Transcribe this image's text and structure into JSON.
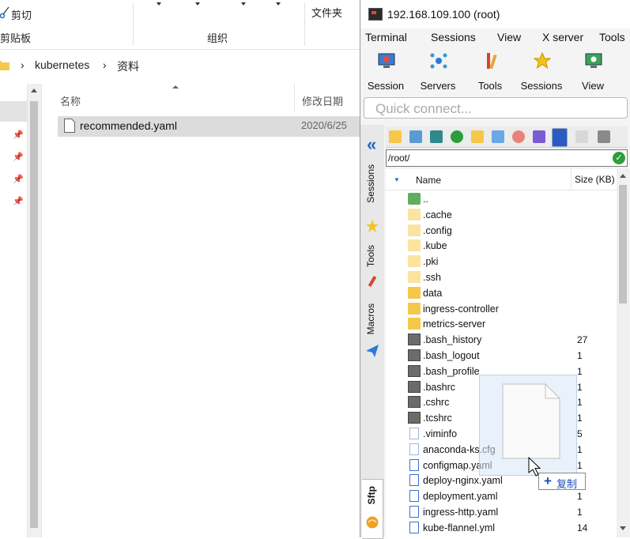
{
  "explorer": {
    "ribbon": {
      "cut_label": "剪切",
      "clipboard_group": "剪贴板",
      "organize_group": "组织",
      "new_folder_label": "文件夹"
    },
    "breadcrumb": [
      "kubernetes",
      "资料"
    ],
    "breadcrumb_separator": "›",
    "columns": {
      "name": "名称",
      "date": "修改日期"
    },
    "files": [
      {
        "name": "recommended.yaml",
        "date": "2020/6/25"
      }
    ]
  },
  "moba": {
    "title": "192.168.109.100 (root)",
    "menu": [
      "Terminal",
      "Sessions",
      "View",
      "X server",
      "Tools"
    ],
    "toolbar": [
      {
        "label": "Session",
        "icon": "monitor-session-icon"
      },
      {
        "label": "Servers",
        "icon": "servers-icon"
      },
      {
        "label": "Tools",
        "icon": "tools-icon"
      },
      {
        "label": "Sessions",
        "icon": "star-sessions-icon"
      },
      {
        "label": "View",
        "icon": "view-monitor-icon"
      }
    ],
    "quick_connect_placeholder": "Quick connect...",
    "side_tabs": [
      "Sessions",
      "Tools",
      "Macros",
      "Sftp"
    ],
    "path": "/root/",
    "list_headers": {
      "name": "Name",
      "size": "Size (KB)"
    },
    "files": [
      {
        "name": "..",
        "type": "up",
        "size": ""
      },
      {
        "name": ".cache",
        "type": "folder-light",
        "size": ""
      },
      {
        "name": ".config",
        "type": "folder-light",
        "size": ""
      },
      {
        "name": ".kube",
        "type": "folder-light",
        "size": ""
      },
      {
        "name": ".pki",
        "type": "folder-light",
        "size": ""
      },
      {
        "name": ".ssh",
        "type": "folder-light",
        "size": ""
      },
      {
        "name": "data",
        "type": "folder",
        "size": ""
      },
      {
        "name": "ingress-controller",
        "type": "folder",
        "size": ""
      },
      {
        "name": "metrics-server",
        "type": "folder",
        "size": ""
      },
      {
        "name": ".bash_history",
        "type": "terminal",
        "size": "27"
      },
      {
        "name": ".bash_logout",
        "type": "terminal",
        "size": "1"
      },
      {
        "name": ".bash_profile",
        "type": "terminal",
        "size": "1"
      },
      {
        "name": ".bashrc",
        "type": "terminal",
        "size": "1"
      },
      {
        "name": ".cshrc",
        "type": "terminal",
        "size": "1"
      },
      {
        "name": ".tcshrc",
        "type": "terminal",
        "size": "1"
      },
      {
        "name": ".viminfo",
        "type": "edit",
        "size": "5"
      },
      {
        "name": "anaconda-ks.cfg",
        "type": "edit",
        "size": "1"
      },
      {
        "name": "configmap.yaml",
        "type": "file",
        "size": "1"
      },
      {
        "name": "deploy-nginx.yaml",
        "type": "file",
        "size": "1"
      },
      {
        "name": "deployment.yaml",
        "type": "file",
        "size": "1"
      },
      {
        "name": "ingress-http.yaml",
        "type": "file",
        "size": "1"
      },
      {
        "name": "kube-flannel.yml",
        "type": "file",
        "size": "14"
      }
    ]
  },
  "drag": {
    "copy_label": "复制",
    "plus": "+"
  }
}
